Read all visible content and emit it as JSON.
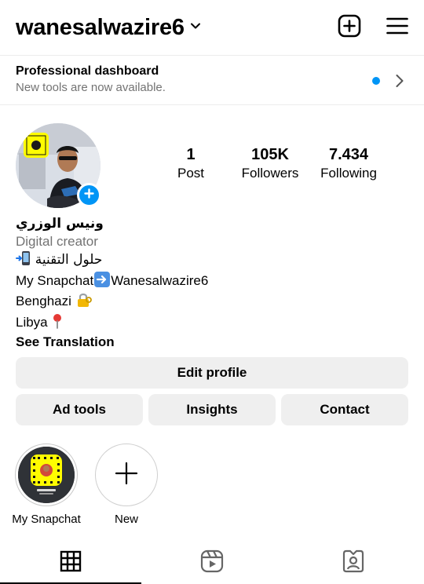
{
  "header": {
    "username": "wanesalwazire6",
    "username_dropdown_icon": "chevron-down-icon",
    "create_icon": "plus-square-icon",
    "menu_icon": "hamburger-menu-icon"
  },
  "dashboard": {
    "title": "Professional dashboard",
    "subtitle": "New tools are now available.",
    "dot_color": "#0095f6"
  },
  "profile": {
    "stats": [
      {
        "value": "1",
        "label": "Post"
      },
      {
        "value": "105K",
        "label": "Followers"
      },
      {
        "value": "7.434",
        "label": "Following"
      }
    ],
    "bio": {
      "name": "ونيس الوزري",
      "category": "Digital creator",
      "line1_text": "حلول التقنية",
      "line2_prefix": "My Snapchat",
      "line2_suffix": "Wanesalwazire6",
      "line3_text": "Benghazi",
      "line4_text": "Libya",
      "translate": "See Translation"
    }
  },
  "buttons": {
    "edit_profile": "Edit profile",
    "ad_tools": "Ad tools",
    "insights": "Insights",
    "contact": "Contact"
  },
  "highlights": [
    {
      "label": "My Snapchat",
      "icon": "snapcode-icon"
    },
    {
      "label": "New",
      "icon": "plus-icon"
    }
  ],
  "tabs": [
    {
      "name": "posts",
      "icon": "grid-icon",
      "active": true
    },
    {
      "name": "reels",
      "icon": "reels-icon",
      "active": false
    },
    {
      "name": "tagged",
      "icon": "tagged-user-icon",
      "active": false
    }
  ],
  "colors": {
    "accent": "#0095f6",
    "button_bg": "#efefef",
    "secondary_text": "#737373",
    "snapchat_yellow": "#fffc00"
  }
}
